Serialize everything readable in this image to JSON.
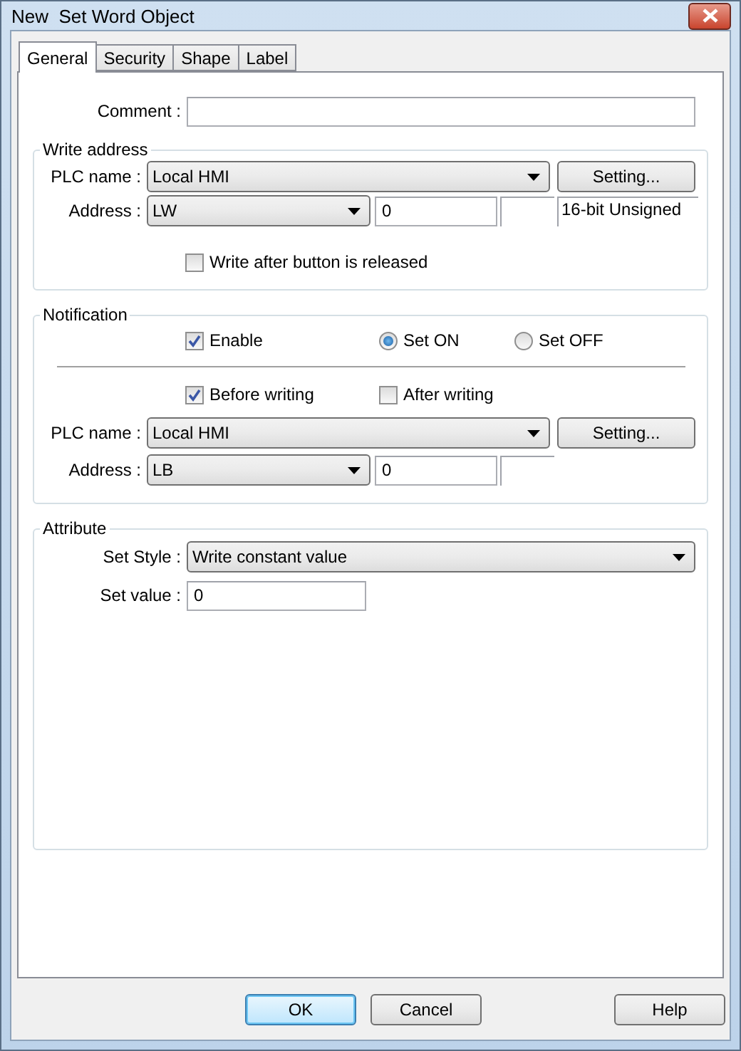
{
  "window": {
    "title": "New  Set Word Object"
  },
  "tabs": [
    {
      "label": "General",
      "selected": true
    },
    {
      "label": "Security",
      "selected": false
    },
    {
      "label": "Shape",
      "selected": false
    },
    {
      "label": "Label",
      "selected": false
    }
  ],
  "comment": {
    "label": "Comment :"
  },
  "write_address": {
    "title": "Write address",
    "plc_name": {
      "label": "PLC name :",
      "value": "Local HMI"
    },
    "setting_button": "Setting...",
    "address": {
      "label": "Address :",
      "device": "LW",
      "value": "0",
      "data_type": "16-bit Unsigned"
    },
    "write_after_release": {
      "label": "Write after button is released",
      "checked": false
    }
  },
  "notification": {
    "title": "Notification",
    "enable": {
      "label": "Enable",
      "checked": true
    },
    "set_mode": [
      {
        "label": "Set ON",
        "selected": true
      },
      {
        "label": "Set OFF",
        "selected": false
      }
    ],
    "before_writing": {
      "label": "Before writing",
      "checked": true
    },
    "after_writing": {
      "label": "After writing",
      "checked": false
    },
    "plc_name": {
      "label": "PLC name :",
      "value": "Local HMI"
    },
    "setting_button": "Setting...",
    "address": {
      "label": "Address :",
      "device": "LB",
      "value": "0"
    }
  },
  "attribute": {
    "title": "Attribute",
    "set_style": {
      "label": "Set Style :",
      "value": "Write constant value"
    },
    "set_value": {
      "label": "Set value :",
      "value": "0"
    }
  },
  "buttons": [
    {
      "label": "OK",
      "default": true
    },
    {
      "label": "Cancel",
      "default": false
    },
    {
      "label": "Help",
      "default": false
    }
  ]
}
